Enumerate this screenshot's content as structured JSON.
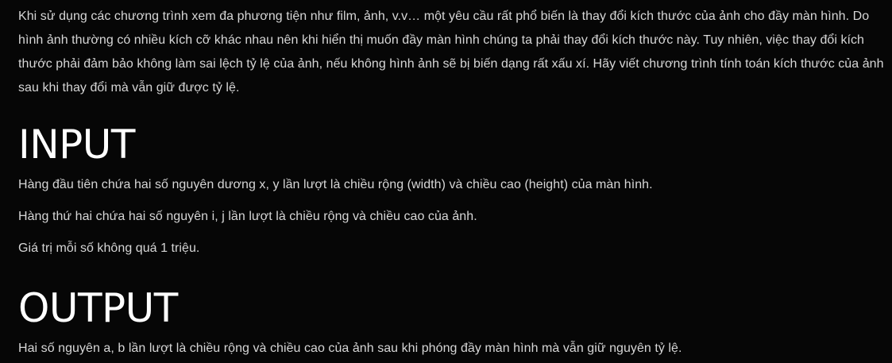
{
  "problem": {
    "statement": "Khi sử dụng các chương trình xem đa phương tiện như film, ảnh, v.v… một yêu cầu rất phổ biến là thay đổi kích thước của ảnh cho đầy màn hình. Do hình ảnh thường có nhiều kích cỡ khác nhau nên khi hiển thị muốn đầy màn hình chúng ta phải thay đổi kích thước này. Tuy nhiên, việc thay đổi kích thước phải đảm bảo không làm sai lệch tỷ lệ của ảnh, nếu không hình ảnh sẽ bị biến dạng rất xấu xí. Hãy viết chương trình tính toán kích thước của ảnh sau khi thay đổi mà vẫn giữ được tỷ lệ."
  },
  "input_section": {
    "heading": "INPUT",
    "lines": [
      "Hàng đầu tiên chứa hai số nguyên dương x, y lần lượt là chiều rộng (width) và chiều cao (height) của màn hình.",
      "Hàng thứ hai chứa hai số nguyên i, j lần lượt là chiều rộng và chiều cao của ảnh.",
      "Giá trị mỗi số không quá 1 triệu."
    ]
  },
  "output_section": {
    "heading": "OUTPUT",
    "lines": [
      "Hai số nguyên a, b lần lượt là chiều rộng và chiều cao của ảnh sau khi phóng đầy màn hình mà vẫn giữ nguyên tỷ lệ."
    ]
  },
  "colors": {
    "background": "#060606",
    "body_text": "#d6d6d6",
    "heading_text": "#ffffff"
  }
}
